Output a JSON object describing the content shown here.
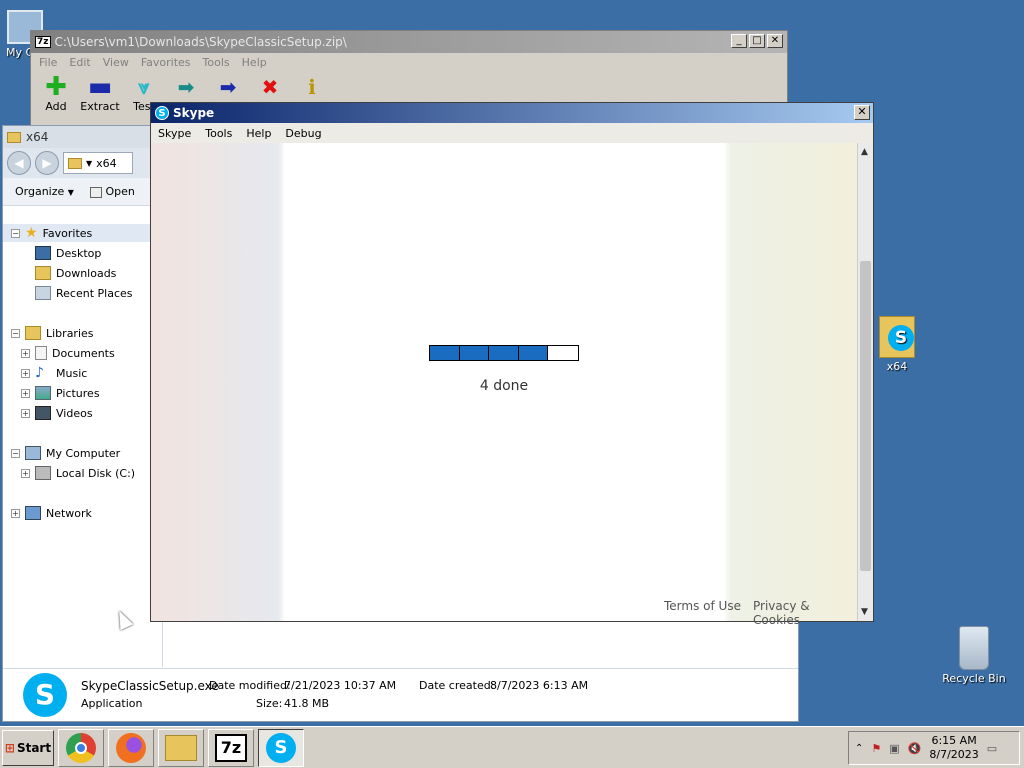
{
  "desktop": {
    "icons": [
      {
        "label": "My C",
        "icon": "computer-icon"
      },
      {
        "label": "x64",
        "icon": "skype-folder-icon"
      },
      {
        "label": "Recycle Bin",
        "icon": "recycle-bin-icon"
      }
    ]
  },
  "zip": {
    "title": "C:\\Users\\vm1\\Downloads\\SkypeClassicSetup.zip\\",
    "logo": "7z",
    "menu": [
      "File",
      "Edit",
      "View",
      "Favorites",
      "Tools",
      "Help"
    ],
    "toolbar": [
      {
        "label": "Add",
        "icon": "plus-icon",
        "color": "#1fae1f"
      },
      {
        "label": "Extract",
        "icon": "minus-icon",
        "color": "#1a2aa8"
      },
      {
        "label": "Test",
        "icon": "check-icon",
        "color": "#28b8c8"
      },
      {
        "label": "Copy",
        "icon": "copy-arrow-icon",
        "color": "#1a8a8a"
      },
      {
        "label": "Move",
        "icon": "move-arrow-icon",
        "color": "#1a2aa8"
      },
      {
        "label": "Delete",
        "icon": "delete-x-icon",
        "color": "#e01010"
      },
      {
        "label": "Info",
        "icon": "info-icon",
        "color": "#e8c000"
      }
    ]
  },
  "explorer": {
    "title": "x64",
    "address": "x64",
    "cmdbar": {
      "organize": "Organize",
      "open": "Open"
    },
    "nav": {
      "favorites": "Favorites",
      "desktop": "Desktop",
      "downloads": "Downloads",
      "recent": "Recent Places",
      "libraries": "Libraries",
      "documents": "Documents",
      "music": "Music",
      "pictures": "Pictures",
      "videos": "Videos",
      "computer": "My Computer",
      "localdisk": "Local Disk (C:)",
      "network": "Network"
    },
    "details": {
      "filename": "SkypeClassicSetup.exe",
      "type": "Application",
      "date_modified_label": "Date modified:",
      "date_modified": "7/21/2023 10:37 AM",
      "date_created_label": "Date created:",
      "date_created": "8/7/2023 6:13 AM",
      "size_label": "Size:",
      "size": "41.8 MB"
    }
  },
  "skype": {
    "title": "Skype",
    "menu": [
      "Skype",
      "Tools",
      "Help",
      "Debug"
    ],
    "progress": {
      "segments_total": 5,
      "segments_done": 4
    },
    "status": "4 done",
    "terms": "Terms of Use",
    "privacy": "Privacy & Cookies"
  },
  "taskbar": {
    "start": "Start",
    "apps": [
      "chrome-icon",
      "firefox-icon",
      "explorer-icon",
      "7zip-icon",
      "skype-icon"
    ],
    "clock_time": "6:15 AM",
    "clock_date": "8/7/2023"
  }
}
